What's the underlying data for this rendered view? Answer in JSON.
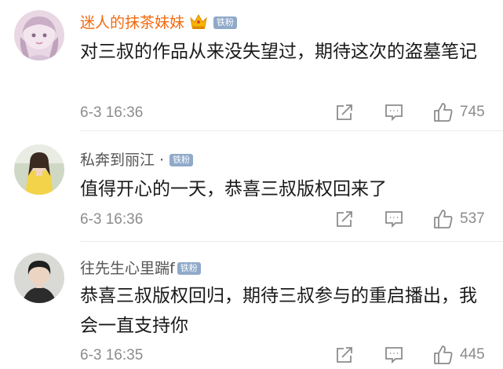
{
  "comments": [
    {
      "username": "迷人的抹茶妹妹",
      "badge": "铁粉",
      "text": "对三叔的作品从来没失望过，期待这次的盗墓笔记",
      "time": "6-3 16:36",
      "likes": "745",
      "name_color": "#f26a0e",
      "has_crown": true
    },
    {
      "username": "私奔到丽江",
      "separator": "·",
      "badge": "铁粉",
      "text": "值得开心的一天，恭喜三叔版权回来了",
      "time": "6-3 16:36",
      "likes": "537",
      "name_color": "#555555"
    },
    {
      "username": "往先生心里踹f",
      "badge": "铁粉",
      "text": "恭喜三叔版权回归，期待三叔参与的重启播出，我会一直支持你",
      "time": "6-3 16:35",
      "likes": "445",
      "name_color": "#555555"
    }
  ],
  "icons": {
    "share": "share-icon",
    "comment": "comment-icon",
    "like": "thumbs-up-icon",
    "vip": "crown-icon"
  },
  "colors": {
    "badge_bg": "#8fa9c9",
    "meta_gray": "#8c8c8c"
  }
}
